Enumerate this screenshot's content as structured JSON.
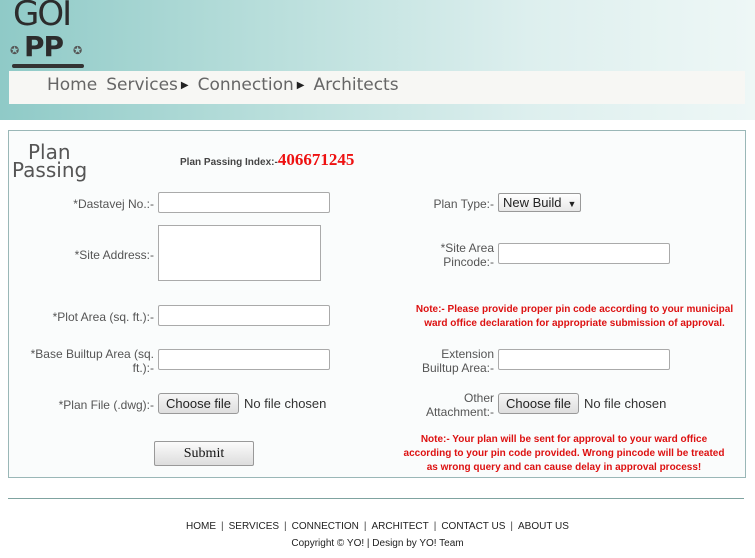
{
  "logo": {
    "line1": "GOI",
    "line2": "PP",
    "star": "✪"
  },
  "nav": [
    {
      "label": "Home",
      "arrow": ""
    },
    {
      "label": "Services",
      "arrow": "▶"
    },
    {
      "label": "Connection",
      "arrow": "▶"
    },
    {
      "label": "Architects",
      "arrow": ""
    }
  ],
  "form": {
    "title_line1": "Plan",
    "title_line2": "Passing",
    "index_label": "Plan Passing Index:-",
    "index_value": "406671245",
    "dastavej_label": "*Dastavej No.:-",
    "site_address_label": "*Site Address:-",
    "plot_area_label": "*Plot Area (sq. ft.):-",
    "base_builtup_label": "*Base Builtup Area (sq. ft.):-",
    "plan_file_label": "*Plan File (.dwg):-",
    "choose_file": "Choose file",
    "no_file": "No file chosen",
    "plan_type_label": "Plan Type:-",
    "plan_type_value": "New Build",
    "pincode_label": "*Site Area Pincode:-",
    "note1": "Note:- Please provide proper pin code according to your municipal ward office declaration for appropriate submission of approval.",
    "extension_label": "Extension Builtup Area:-",
    "other_attachment_label": "Other Attachment:-",
    "note2": "Note:- Your plan will be sent for approval to your ward office according to your pin code provided. Wrong pincode will be treated as wrong query and can cause delay in approval process!",
    "submit": "Submit"
  },
  "footer": {
    "links": [
      "HOME",
      "SERVICES",
      "CONNECTION",
      "ARCHITECT",
      "CONTACT US",
      "ABOUT US"
    ],
    "copyright": "Copyright © YO! | Design by YO! Team"
  }
}
